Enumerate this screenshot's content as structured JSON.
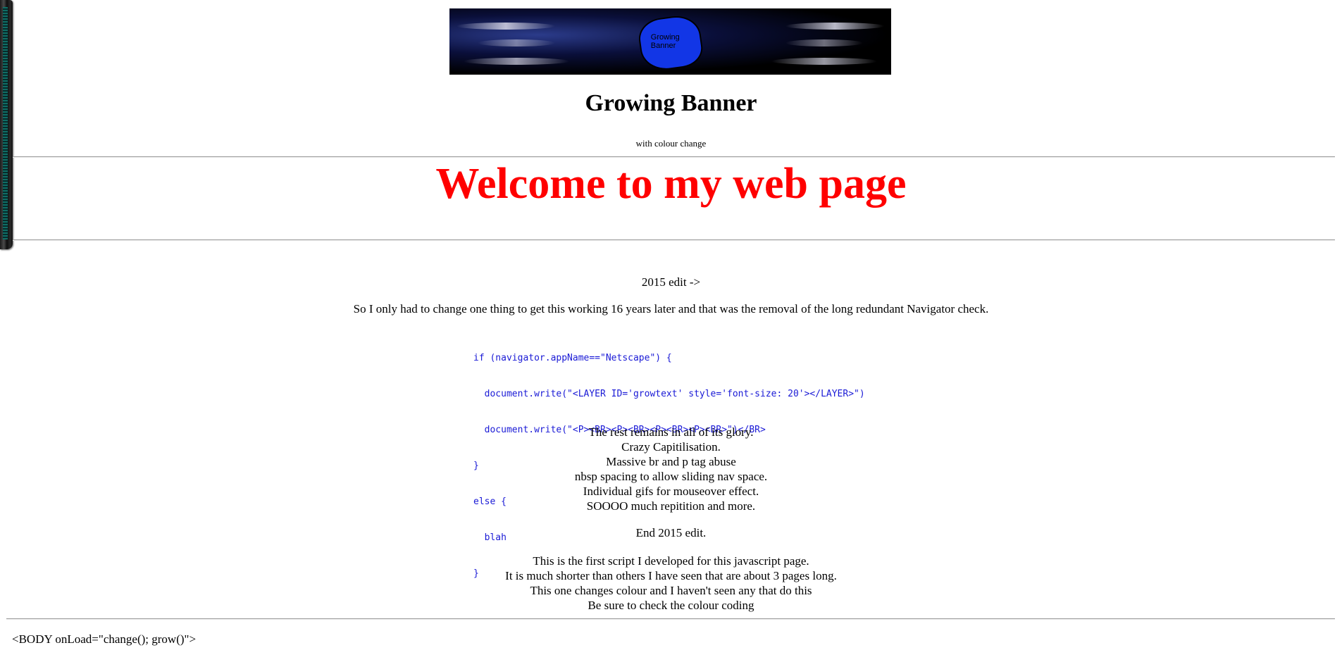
{
  "banner": {
    "badge_text": "Growing Banner"
  },
  "header": {
    "title": "Growing Banner",
    "subtitle": "with colour change"
  },
  "welcome": {
    "text": "Welcome to my web page",
    "color": "#ff0000"
  },
  "edit_2015": {
    "heading": "2015 edit ->",
    "intro": "So I only had to change one thing to get this working 16 years later and that was the removal of the long redundant Navigator check.",
    "code_lines": [
      "if (navigator.appName==\"Netscape\") {",
      "  document.write(\"<LAYER ID='growtext' style='font-size: 20'></LAYER>\")",
      "  document.write(\"<P><BR><P><BR><P><BR><P><BR>\")</BR>",
      "}",
      "else {",
      "  blah",
      "}"
    ],
    "code_color": "#1a1ad6",
    "rest_lines": [
      "The rest remains in all of its glory.",
      "Crazy Capitilisation.",
      "Massive br and p tag abuse",
      "nbsp spacing to allow sliding nav space.",
      "Individual gifs for mouseover effect.",
      "SOOOO much repitition and more."
    ],
    "end": "End 2015 edit."
  },
  "description": {
    "lines": [
      "This is the first script I developed for this javascript page.",
      "It is much shorter than others I have seen that are about 3 pages long.",
      "This one changes colour and I haven't seen any that do this",
      "Be sure to check the colour coding"
    ]
  },
  "footer": {
    "code": "<BODY onLoad=\"change(); grow()\">"
  }
}
